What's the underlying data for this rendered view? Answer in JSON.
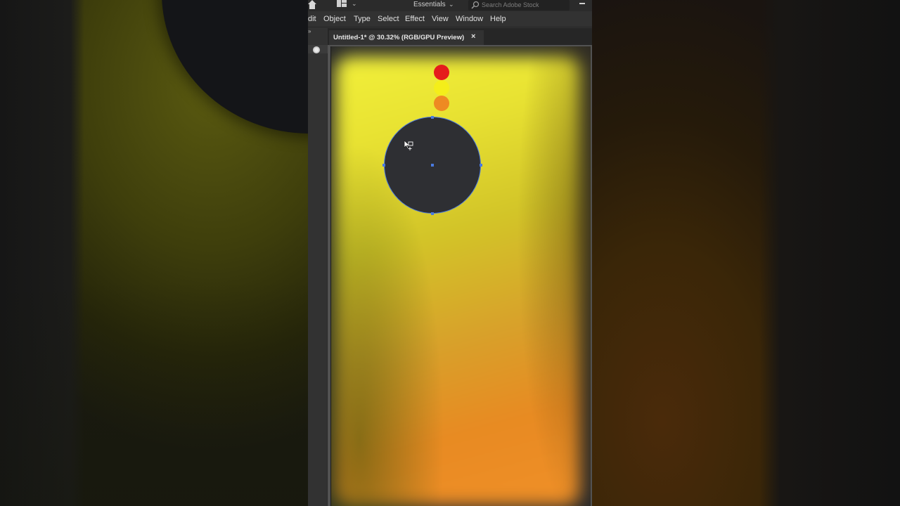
{
  "app": {
    "workspace": "Essentials",
    "stock_search_placeholder": "Search Adobe Stock"
  },
  "menu": {
    "items": [
      "dit",
      "Object",
      "Type",
      "Select",
      "Effect",
      "View",
      "Window",
      "Help"
    ]
  },
  "document": {
    "tab_title": "Untitled-1* @ 30.32% (RGB/GPU Preview)",
    "close_glyph": "×"
  },
  "swatches": [
    {
      "name": "red",
      "color": "#e51c1c"
    },
    {
      "name": "yellow",
      "color": "#f4ee1a"
    },
    {
      "name": "orange",
      "color": "#ee8a22"
    }
  ],
  "shape": {
    "fill": "#2e2f33",
    "selection_color": "#4a7ae0"
  },
  "colors": {
    "ui_background": "#323232",
    "gradient_top": "#f2f03a",
    "gradient_bottom": "#f09028"
  }
}
